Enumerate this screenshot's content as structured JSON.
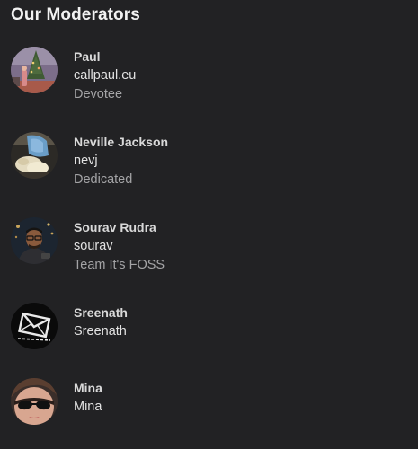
{
  "heading": "Our Moderators",
  "moderators": [
    {
      "name": "Paul",
      "username": "callpaul.eu",
      "title": "Devotee",
      "avatar": "photo-avatar-christmas-tree"
    },
    {
      "name": "Neville Jackson",
      "username": "nevj",
      "title": "Dedicated",
      "avatar": "photo-avatar-blue-shirt"
    },
    {
      "name": "Sourav Rudra",
      "username": "sourav",
      "title": "Team It's FOSS",
      "avatar": "photo-avatar-man-glasses"
    },
    {
      "name": "Sreenath",
      "username": "Sreenath",
      "avatar": "envelope-icon"
    },
    {
      "name": "Mina",
      "username": "Mina",
      "avatar": "photo-avatar-sunglasses"
    }
  ],
  "colors": {
    "background": "#222224",
    "heading": "#f2f2f2",
    "name": "#d9d9d9",
    "username": "#e2e2e2",
    "title": "#a4a4a6"
  }
}
